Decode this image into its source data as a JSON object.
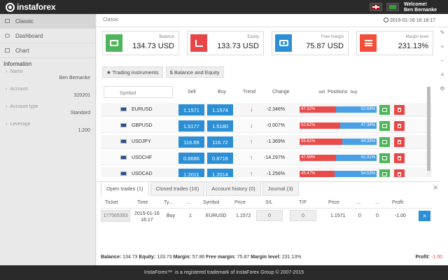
{
  "app": {
    "logo_text": "instaforex"
  },
  "header": {
    "welcome_label": "Welcome!",
    "user_name": "Ben Bernanke"
  },
  "sidebar": {
    "items": [
      {
        "label": "Classic"
      },
      {
        "label": "Dashboard"
      },
      {
        "label": "Chart"
      }
    ],
    "info_title": "Information",
    "info": [
      {
        "label": "Name",
        "value": "Ben Bernanke"
      },
      {
        "label": "Account",
        "value": "320201"
      },
      {
        "label": "Account type",
        "value": "Standard"
      },
      {
        "label": "Leverage",
        "value": "1:200"
      }
    ]
  },
  "main": {
    "breadcrumb": "Classic",
    "datetime": "2015-01-16 16:18:17",
    "cards": [
      {
        "label": "Balance",
        "value": "134.73 USD",
        "color": "#4fb55a"
      },
      {
        "label": "Equity",
        "value": "133.73 USD",
        "color": "#e84646"
      },
      {
        "label": "Free margin",
        "value": "75.87 USD",
        "color": "#2c8fd6"
      },
      {
        "label": "Margin level",
        "value": "231.13%",
        "color": "#f0503a"
      }
    ],
    "tabs": [
      {
        "label": "★ Trading instruments"
      },
      {
        "label": "$ Balance and Equity"
      }
    ],
    "grid": {
      "symbol_placeholder": "Symbol",
      "headers": {
        "sell": "Sell",
        "buy": "Buy",
        "trend": "Trend",
        "change": "Change",
        "positions": "Positions",
        "sell_small": "sell",
        "buy_small": "buy"
      },
      "rows": [
        {
          "symbol": "EURUSD",
          "sell": "1.1571",
          "buy": "1.1574",
          "trend": "down",
          "change": "-2.346%",
          "sell_pct": "47.32%",
          "buy_pct": "52.68%",
          "sell_frac": 0.4732
        },
        {
          "symbol": "GBPUSD",
          "sell": "1.5177",
          "buy": "1.5180",
          "trend": "down",
          "change": "-0.007%",
          "sell_pct": "52.62%",
          "buy_pct": "47.38%",
          "sell_frac": 0.5262
        },
        {
          "symbol": "USDJPY",
          "sell": "116.69",
          "buy": "116.72",
          "trend": "up",
          "change": "-1.369%",
          "sell_pct": "55.61%",
          "buy_pct": "44.39%",
          "sell_frac": 0.5561
        },
        {
          "symbol": "USDCHF",
          "sell": "0.8686",
          "buy": "0.8716",
          "trend": "up",
          "change": "-14.297%",
          "sell_pct": "47.69%",
          "buy_pct": "52.31%",
          "sell_frac": 0.4769
        },
        {
          "symbol": "USDCAD",
          "sell": "1.2011",
          "buy": "1.2014",
          "trend": "up",
          "change": "-1.256%",
          "sell_pct": "45.47%",
          "buy_pct": "54.53%",
          "sell_frac": 0.4547
        }
      ]
    }
  },
  "bottom": {
    "tabs": [
      {
        "label": "Open trades (1)"
      },
      {
        "label": "Closed trades (16)"
      },
      {
        "label": "Account history (0)"
      },
      {
        "label": "Journal (3)"
      }
    ],
    "headers": {
      "ticket": "Ticket",
      "time": "Time",
      "type": "Ty...",
      "dots1": "...",
      "symbol": "Symbol",
      "price": "Price",
      "sl": "S/L",
      "tp": "T/P",
      "price2": "Price",
      "dots2": "...",
      "dots3": "...",
      "profit": "Profit"
    },
    "trade": {
      "ticket": "177565393",
      "time_date": "2015-01-16",
      "time_clock": "16:17",
      "type": "Buy",
      "volume": "1",
      "symbol": "EURUSD",
      "price": "1.1572",
      "sl": "0",
      "tp": "0",
      "price2": "1.1571",
      "c1": "0",
      "c2": "0",
      "profit": "-1.00",
      "close": "✕"
    }
  },
  "summary": {
    "balance_label": "Balance:",
    "balance": "134.73",
    "equity_label": "Equity:",
    "equity": "133.73",
    "margin_label": "Margin:",
    "margin": "57.86",
    "free_margin_label": "Free margin:",
    "free_margin": "75.87",
    "margin_level_label": "Margin level:",
    "margin_level": "231.13%",
    "profit_label": "Profit:",
    "profit": "-1.00"
  },
  "footer": {
    "brand": "InstaForex™",
    "text": "is a registered trademark of InstaForex Group © 2007-2015"
  }
}
